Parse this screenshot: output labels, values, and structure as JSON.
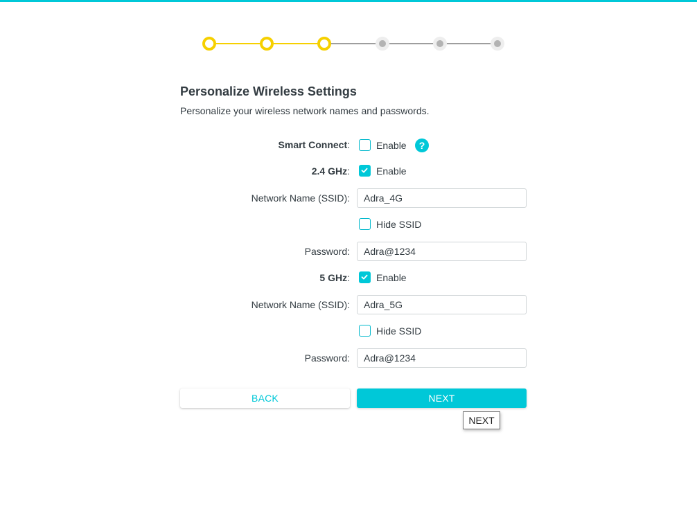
{
  "colors": {
    "accent": "#00c8d8",
    "step_done": "#f6d000",
    "step_todo": "#b3b3b3",
    "text": "#333c42"
  },
  "stepper": {
    "total_steps": 6,
    "completed_steps": 3
  },
  "page": {
    "title": "Personalize Wireless Settings",
    "subtitle": "Personalize your wireless network names and passwords."
  },
  "smart_connect": {
    "label": "Smart Connect",
    "checkbox_label": "Enable",
    "checked": false,
    "help_icon": "?"
  },
  "band_24": {
    "label": "2.4 GHz",
    "checkbox_label": "Enable",
    "checked": true,
    "ssid_label": "Network Name (SSID):",
    "ssid_value": "Adra_4G",
    "hide_ssid_label": "Hide SSID",
    "hide_ssid_checked": false,
    "password_label": "Password:",
    "password_value": "Adra@1234"
  },
  "band_5": {
    "label": "5 GHz",
    "checkbox_label": "Enable",
    "checked": true,
    "ssid_label": "Network Name (SSID):",
    "ssid_value": "Adra_5G",
    "hide_ssid_label": "Hide SSID",
    "hide_ssid_checked": false,
    "password_label": "Password:",
    "password_value": "Adra@1234"
  },
  "buttons": {
    "back": "BACK",
    "next": "NEXT"
  },
  "tooltip": {
    "text": "NEXT"
  }
}
